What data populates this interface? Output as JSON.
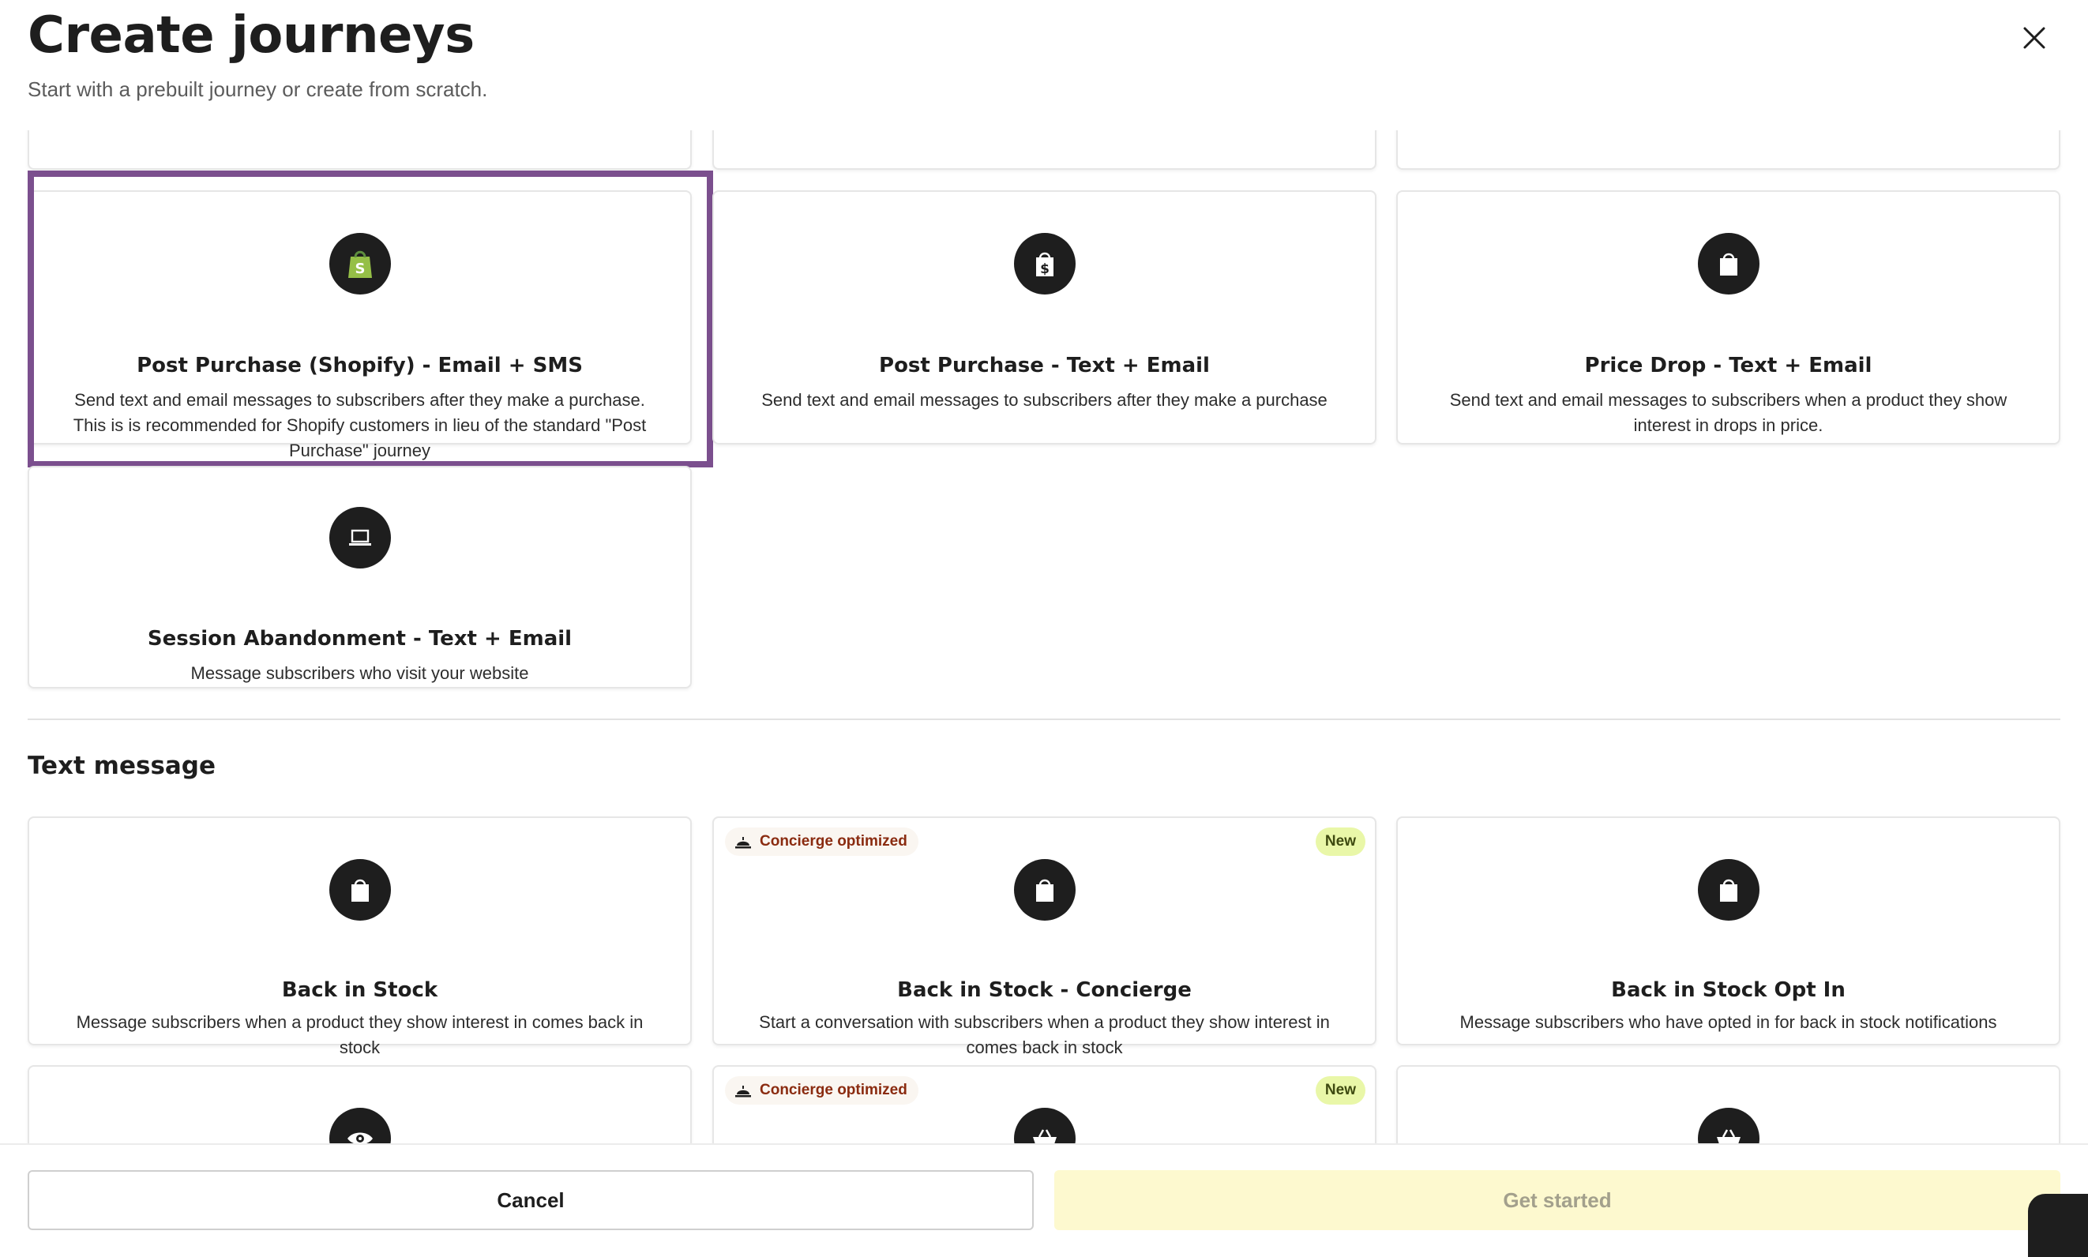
{
  "header": {
    "title": "Create journeys",
    "subtitle": "Start with a prebuilt journey or create from scratch."
  },
  "email_sms_cards": [
    {
      "title": "Post Purchase (Shopify) - Email + SMS",
      "description": "Send text and email messages to subscribers after they make a purchase. This is is recommended for Shopify customers in lieu of the standard \"Post Purchase\" journey",
      "icon": "shopify-bag-icon",
      "selected": true
    },
    {
      "title": "Post Purchase - Text + Email",
      "description": "Send text and email messages to subscribers after they make a purchase",
      "icon": "dollar-bag-icon"
    },
    {
      "title": "Price Drop - Text + Email",
      "description": "Send text and email messages to subscribers when a product they show interest in drops in price.",
      "icon": "shopping-bag-icon"
    },
    {
      "title": "Session Abandonment - Text + Email",
      "description": "Message subscribers who visit your website",
      "icon": "laptop-icon"
    }
  ],
  "text_message_section": {
    "title": "Text message",
    "cards": [
      {
        "title": "Back in Stock",
        "description": "Message subscribers when a product they show interest in comes back in stock",
        "icon": "shopping-bag-icon"
      },
      {
        "title": "Back in Stock - Concierge",
        "description": "Start a conversation with subscribers when a product they show interest in comes back in stock",
        "icon": "shopping-bag-icon",
        "badge": "Concierge optimized",
        "new_badge": "New"
      },
      {
        "title": "Back in Stock Opt In",
        "description": "Message subscribers who have opted in for back in stock notifications",
        "icon": "shopping-bag-icon"
      }
    ],
    "partial_cards": [
      {
        "icon": "eye-icon"
      },
      {
        "icon": "basket-icon",
        "badge": "Concierge optimized",
        "new_badge": "New"
      },
      {
        "icon": "basket-icon"
      }
    ]
  },
  "footer": {
    "cancel_label": "Cancel",
    "get_started_label": "Get started"
  },
  "colors": {
    "selection_border": "#7b4f8e",
    "icon_bg": "#1e1e1e",
    "get_started_bg": "#fdf9cf",
    "new_badge_bg": "#e9f7a8",
    "concierge_text": "#8a2b10",
    "shopify_green": "#95bf47"
  }
}
